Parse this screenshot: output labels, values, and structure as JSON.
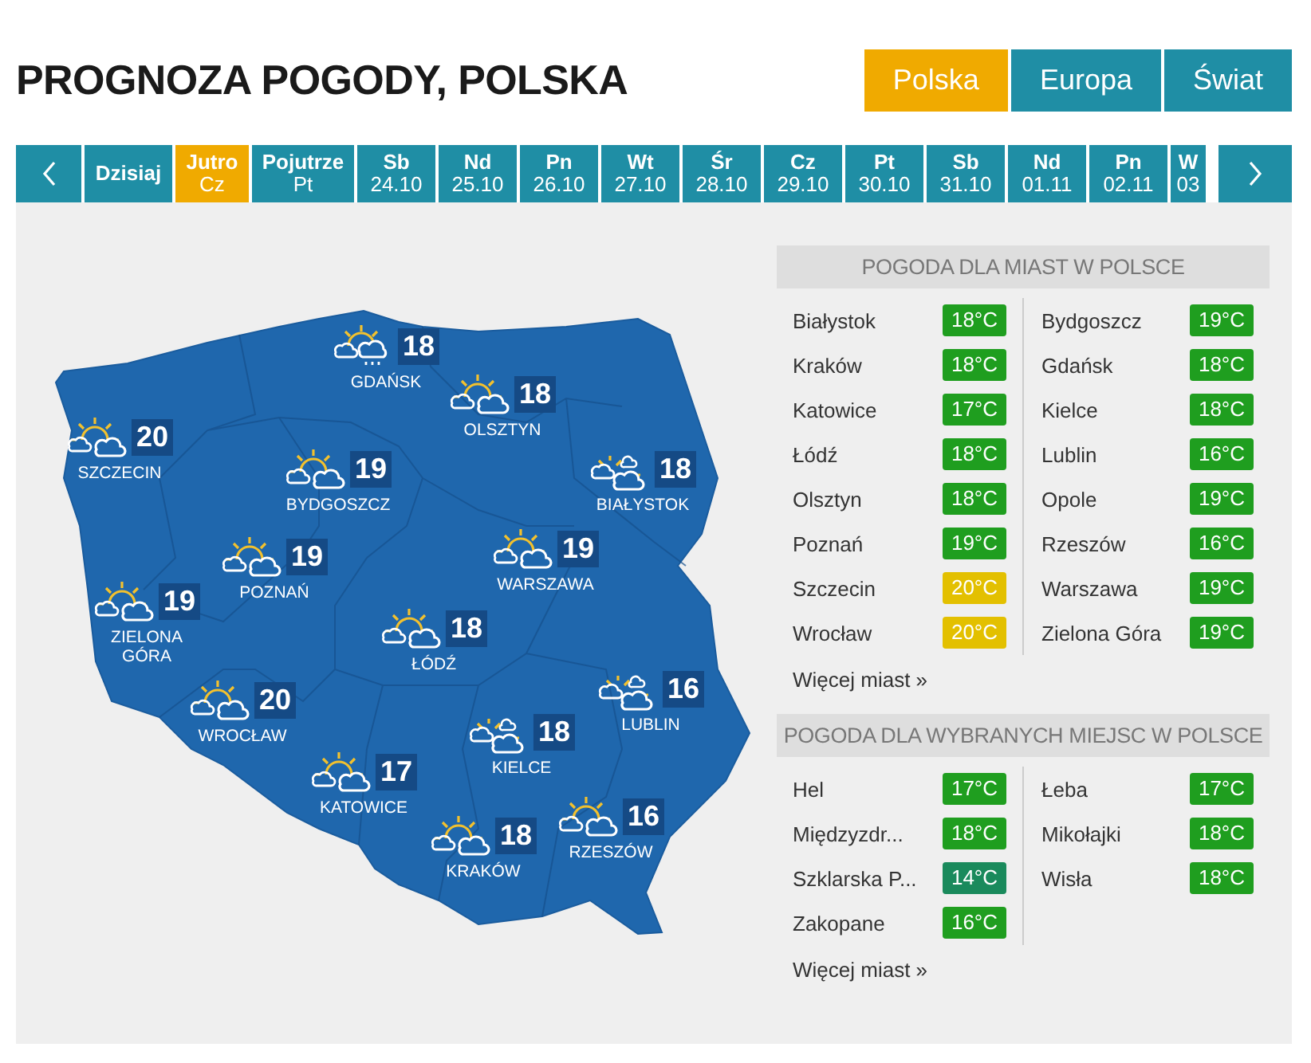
{
  "title": "PROGNOZA POGODY, POLSKA",
  "regions": [
    {
      "label": "Polska",
      "selected": true
    },
    {
      "label": "Europa",
      "selected": false
    },
    {
      "label": "Świat",
      "selected": false
    }
  ],
  "days": [
    {
      "day": "Dzisiaj",
      "selected": false
    },
    {
      "day": "Jutro",
      "date": "Cz",
      "selected": true
    },
    {
      "day": "Pojutrze",
      "date": "Pt",
      "selected": false
    },
    {
      "day": "Sb",
      "date": "24.10",
      "selected": false
    },
    {
      "day": "Nd",
      "date": "25.10",
      "selected": false
    },
    {
      "day": "Pn",
      "date": "26.10",
      "selected": false
    },
    {
      "day": "Wt",
      "date": "27.10",
      "selected": false
    },
    {
      "day": "Śr",
      "date": "28.10",
      "selected": false
    },
    {
      "day": "Cz",
      "date": "29.10",
      "selected": false
    },
    {
      "day": "Pt",
      "date": "30.10",
      "selected": false
    },
    {
      "day": "Sb",
      "date": "31.10",
      "selected": false
    },
    {
      "day": "Nd",
      "date": "01.11",
      "selected": false
    },
    {
      "day": "Pn",
      "date": "02.11",
      "selected": false
    },
    {
      "day": "W",
      "date": "03",
      "selected": false
    }
  ],
  "map_cities": [
    {
      "name": "GDAŃSK",
      "temp": "18",
      "kind": "sun-cloud-rain"
    },
    {
      "name": "OLSZTYN",
      "temp": "18",
      "kind": "sun-cloud"
    },
    {
      "name": "SZCZECIN",
      "temp": "20",
      "kind": "sun-cloud"
    },
    {
      "name": "BYDGOSZCZ",
      "temp": "19",
      "kind": "sun-cloud"
    },
    {
      "name": "BIAŁYSTOK",
      "temp": "18",
      "kind": "sun-clouds"
    },
    {
      "name": "POZNAŃ",
      "temp": "19",
      "kind": "sun-cloud"
    },
    {
      "name": "WARSZAWA",
      "temp": "19",
      "kind": "sun-cloud"
    },
    {
      "name": "ZIELONA GÓRA",
      "temp": "19",
      "kind": "sun-cloud"
    },
    {
      "name": "ŁÓDŹ",
      "temp": "18",
      "kind": "sun-cloud"
    },
    {
      "name": "WROCŁAW",
      "temp": "20",
      "kind": "sun-cloud"
    },
    {
      "name": "LUBLIN",
      "temp": "16",
      "kind": "sun-clouds"
    },
    {
      "name": "KIELCE",
      "temp": "18",
      "kind": "sun-clouds"
    },
    {
      "name": "KATOWICE",
      "temp": "17",
      "kind": "sun-cloud"
    },
    {
      "name": "RZESZÓW",
      "temp": "16",
      "kind": "sun-cloud"
    },
    {
      "name": "KRAKÓW",
      "temp": "18",
      "kind": "sun-cloud"
    }
  ],
  "tables": [
    {
      "title": "POGODA DLA MIAST W POLSCE",
      "more": "Więcej miast »",
      "columns": [
        [
          {
            "name": "Białystok",
            "temp": "18°C",
            "color": "#1f9e1f"
          },
          {
            "name": "Kraków",
            "temp": "18°C",
            "color": "#1f9e1f"
          },
          {
            "name": "Katowice",
            "temp": "17°C",
            "color": "#1f9e1f"
          },
          {
            "name": "Łódź",
            "temp": "18°C",
            "color": "#1f9e1f"
          },
          {
            "name": "Olsztyn",
            "temp": "18°C",
            "color": "#1f9e1f"
          },
          {
            "name": "Poznań",
            "temp": "19°C",
            "color": "#1f9e1f"
          },
          {
            "name": "Szczecin",
            "temp": "20°C",
            "color": "#e3c000"
          },
          {
            "name": "Wrocław",
            "temp": "20°C",
            "color": "#e3c000"
          }
        ],
        [
          {
            "name": "Bydgoszcz",
            "temp": "19°C",
            "color": "#1f9e1f"
          },
          {
            "name": "Gdańsk",
            "temp": "18°C",
            "color": "#1f9e1f"
          },
          {
            "name": "Kielce",
            "temp": "18°C",
            "color": "#1f9e1f"
          },
          {
            "name": "Lublin",
            "temp": "16°C",
            "color": "#1f9e1f"
          },
          {
            "name": "Opole",
            "temp": "19°C",
            "color": "#1f9e1f"
          },
          {
            "name": "Rzeszów",
            "temp": "16°C",
            "color": "#1f9e1f"
          },
          {
            "name": "Warszawa",
            "temp": "19°C",
            "color": "#1f9e1f"
          },
          {
            "name": "Zielona Góra",
            "temp": "19°C",
            "color": "#1f9e1f"
          }
        ]
      ]
    },
    {
      "title": "POGODA DLA WYBRANYCH MIEJSC W POLSCE",
      "more": "Więcej miast »",
      "columns": [
        [
          {
            "name": "Hel",
            "temp": "17°C",
            "color": "#1f9e1f"
          },
          {
            "name": "Międzyzdr...",
            "temp": "18°C",
            "color": "#1f9e1f"
          },
          {
            "name": "Szklarska P...",
            "temp": "14°C",
            "color": "#1a8a5c"
          },
          {
            "name": "Zakopane",
            "temp": "16°C",
            "color": "#1f9e1f"
          }
        ],
        [
          {
            "name": "Łeba",
            "temp": "17°C",
            "color": "#1f9e1f"
          },
          {
            "name": "Mikołajki",
            "temp": "18°C",
            "color": "#1f9e1f"
          },
          {
            "name": "Wisła",
            "temp": "18°C",
            "color": "#1f9e1f"
          }
        ]
      ]
    }
  ]
}
